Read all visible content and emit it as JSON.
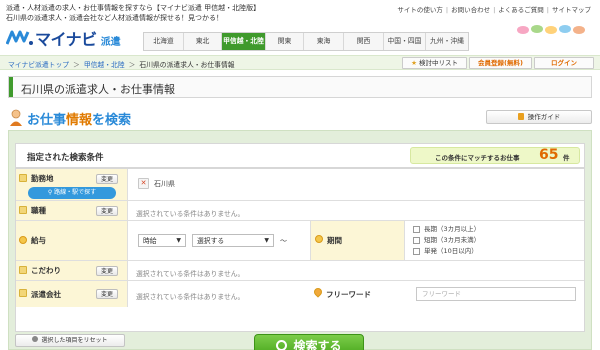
{
  "header": {
    "intro_line1": "派遣・人材派遣の求人・お仕事情報を探すなら【マイナビ派遣 甲信越・北陸版】",
    "intro_line2": "石川県の派遣求人・派遣会社など人材派遣情報が探せる！見つかる！",
    "top_links": [
      "サイトの使い方",
      "お問い合わせ",
      "よくあるご質問",
      "サイトマップ"
    ],
    "logo_text": "マイナビ",
    "logo_sub": "派遣"
  },
  "region_nav": {
    "items": [
      "北海道",
      "東北",
      "甲信越・北陸",
      "関東",
      "東海",
      "関西",
      "中国・四国",
      "九州・沖縄"
    ],
    "active": "甲信越・北陸"
  },
  "breadcrumb": {
    "items": [
      "マイナビ派遣トップ",
      "甲信越・北陸",
      "石川県の派遣求人・お仕事情報"
    ],
    "separator": "＞"
  },
  "account": {
    "saved_label": "検討中リスト",
    "register_label": "会員登録(無料)",
    "login_label": "ログイン"
  },
  "page_title": {
    "prefix": "石川県",
    "suffix": "の派遣求人・お仕事情報"
  },
  "search": {
    "title_pre": "お仕事",
    "title_mid": "情報",
    "title_post": "を検索",
    "guide_label": "操作ガイド",
    "conditions_label": "指定された検索条件",
    "match_text": "この条件にマッチするお仕事",
    "match_count": "65",
    "match_unit": "件",
    "change_label": "変更",
    "empty_text": "選択されている条件はありません。",
    "rows": {
      "location": {
        "label": "勤務地",
        "route_button": "路線・駅で探す",
        "selected": "石川県"
      },
      "job_type": {
        "label": "職種"
      },
      "salary": {
        "label": "給与",
        "unit_value": "時給",
        "amount_value": "選択する",
        "tilde": "〜"
      },
      "period": {
        "label": "期間",
        "options": [
          "長期（3カ月以上）",
          "短期（3カ月未満）",
          "単発（10日以内）"
        ]
      },
      "preference": {
        "label": "こだわり"
      },
      "agency": {
        "label": "派遣会社"
      },
      "freeword": {
        "label": "フリーワード",
        "placeholder": "フリーワード"
      }
    },
    "reset_label": "選択した項目をリセット",
    "search_label": "検索する"
  },
  "colors": {
    "brand_blue": "#1a4a9c",
    "accent_green": "#3f9a2c",
    "accent_orange": "#e06a00",
    "label_bg": "#fcf6d6"
  }
}
